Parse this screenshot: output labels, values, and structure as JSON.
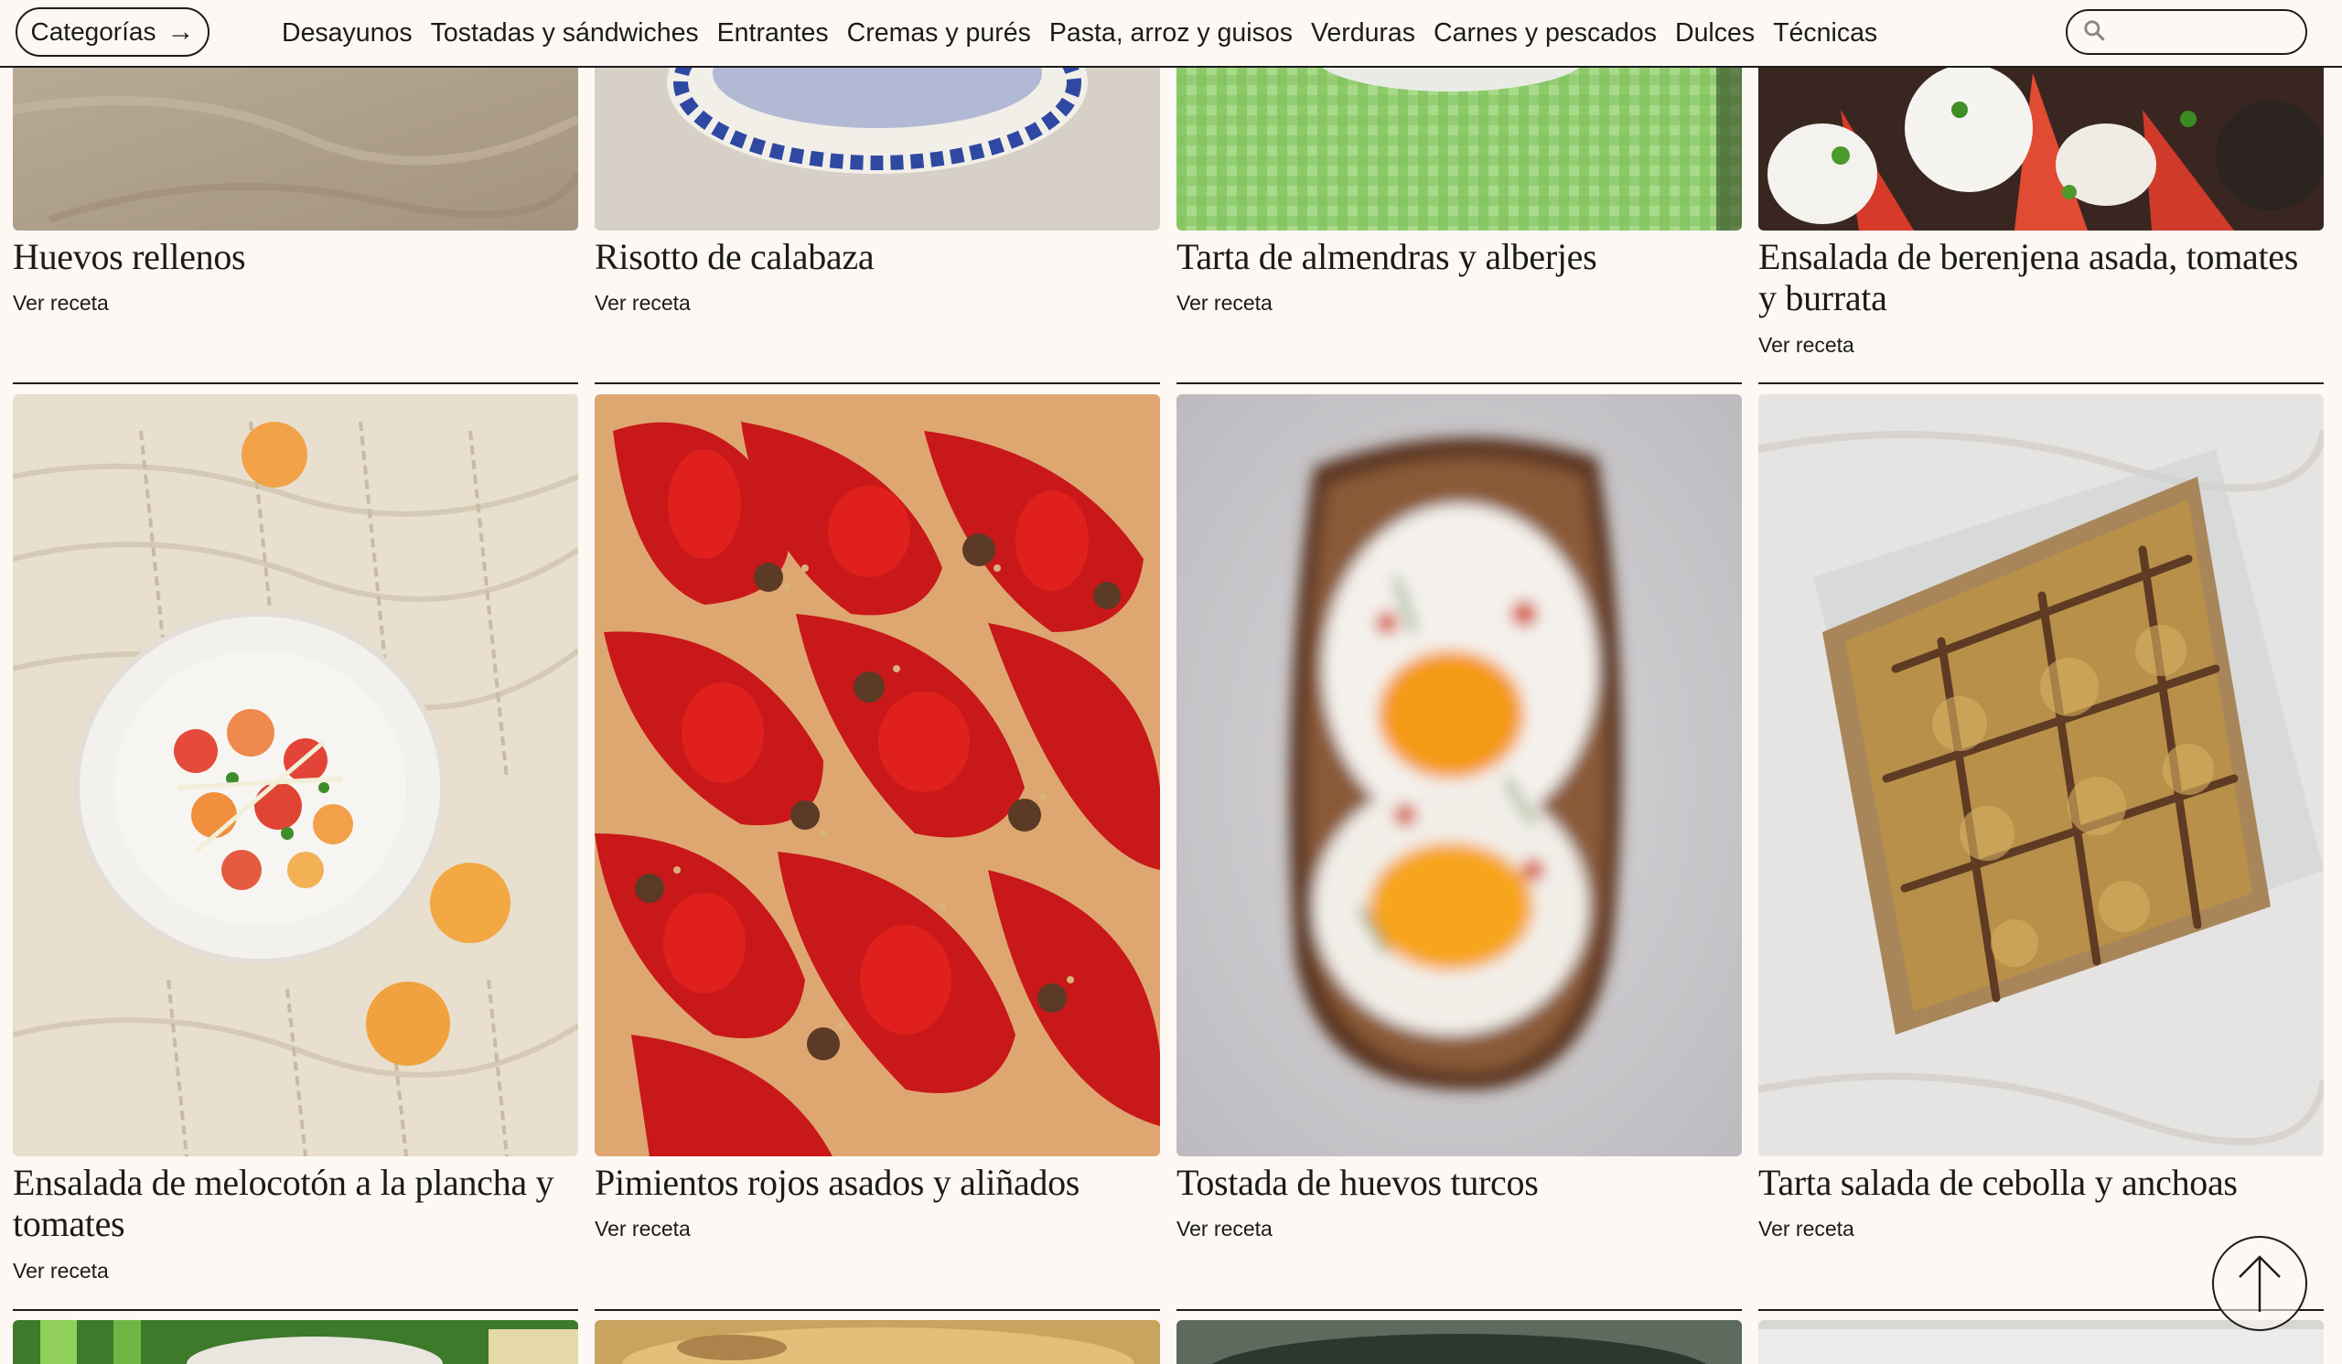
{
  "header": {
    "categories_label": "Categorías",
    "arrow_glyph": "→",
    "nav": [
      "Desayunos",
      "Tostadas y sándwiches",
      "Entrantes",
      "Cremas y purés",
      "Pasta, arroz y guisos",
      "Verduras",
      "Carnes y pescados",
      "Dulces",
      "Técnicas"
    ],
    "search_placeholder": ""
  },
  "recipes_top": [
    {
      "title": "Huevos rellenos",
      "link": "Ver receta"
    },
    {
      "title": "Risotto de calabaza",
      "link": "Ver receta"
    },
    {
      "title": "Tarta de almendras y alberjes",
      "link": "Ver receta"
    },
    {
      "title": "Ensalada de berenjena asada, tomates y burrata",
      "link": "Ver receta"
    }
  ],
  "recipes_middle": [
    {
      "title": "Ensalada de melocotón a la plancha y tomates",
      "link": "Ver receta"
    },
    {
      "title": "Pimientos rojos asados y aliñados",
      "link": "Ver receta"
    },
    {
      "title": "Tostada de huevos turcos",
      "link": "Ver receta"
    },
    {
      "title": "Tarta salada de cebolla y anchoas",
      "link": "Ver receta"
    }
  ],
  "colors": {
    "background": "#fdf8f3",
    "ink": "#1b1b1b"
  },
  "icons": {
    "search": "search-icon",
    "back_to_top": "arrow-up-icon"
  }
}
